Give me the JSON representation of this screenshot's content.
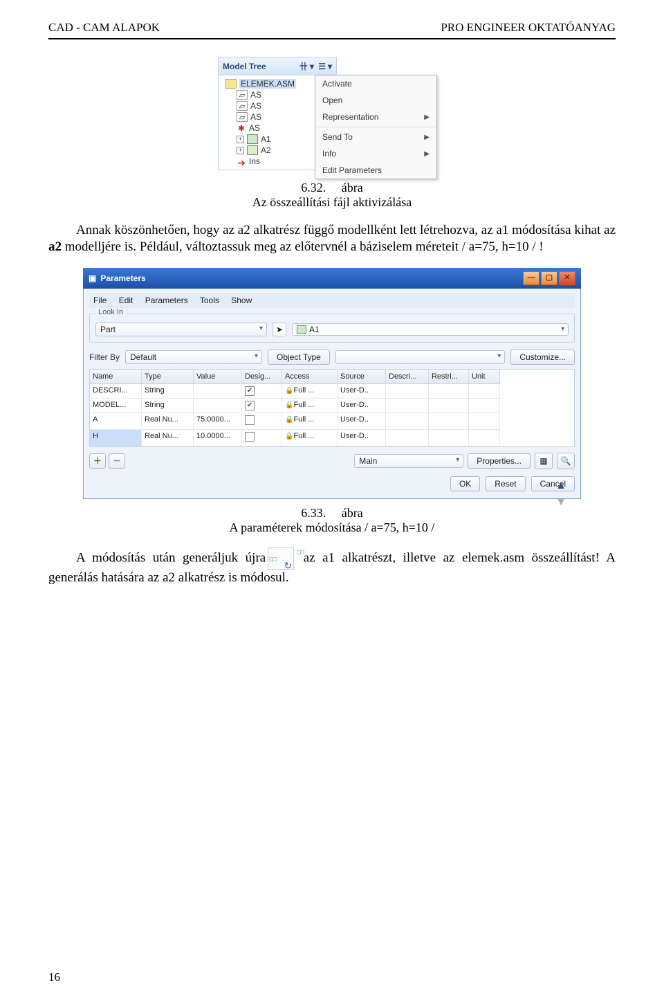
{
  "header": {
    "left": "CAD - CAM ALAPOK",
    "right": "PRO ENGINEER OKTATÓANYAG"
  },
  "shot1": {
    "tree_title": "Model Tree",
    "root": "ELEMEK.ASM",
    "children": [
      "AS",
      "AS",
      "AS",
      "AS",
      "A1",
      "A2",
      "Ins"
    ],
    "ctx": {
      "activate": "Activate",
      "open": "Open",
      "representation": "Representation",
      "sendto": "Send To",
      "info": "Info",
      "editparams": "Edit Parameters"
    }
  },
  "caption1": {
    "num": "6.32.",
    "label": "ábra",
    "text": "Az összeállítási fájl aktivizálása"
  },
  "para1_a": "Annak köszönhetően, hogy az a2 alkatrész függő modellként lett létrehozva, az a1 módosítása kihat az ",
  "para1_b": "a2",
  "para1_c": " modelljére is. Például, változtassuk meg az előtervnél a báziselem méreteit / a=75, h=10 / !",
  "shot2": {
    "title": "Parameters",
    "menu": [
      "File",
      "Edit",
      "Parameters",
      "Tools",
      "Show"
    ],
    "lookin": "Look In",
    "part_combo": "Part",
    "partname": "A1",
    "filterby": "Filter By",
    "filter_default": "Default",
    "object_type": "Object Type",
    "customize": "Customize...",
    "cols": [
      "Name",
      "Type",
      "Value",
      "Desig...",
      "Access",
      "Source",
      "Descri...",
      "Restri...",
      "Unit"
    ],
    "rows": [
      {
        "name": "DESCRI...",
        "type": "String",
        "value": "",
        "desig": true,
        "access": "Full ...",
        "source": "User-D..",
        "descr": "",
        "restr": "",
        "unit": ""
      },
      {
        "name": "MODEL...",
        "type": "String",
        "value": "",
        "desig": true,
        "access": "Full ...",
        "source": "User-D..",
        "descr": "",
        "restr": "",
        "unit": ""
      },
      {
        "name": "A",
        "type": "Real Nu...",
        "value": "75.0000...",
        "desig": false,
        "access": "Full ...",
        "source": "User-D..",
        "descr": "",
        "restr": "",
        "unit": ""
      },
      {
        "name": "H",
        "type": "Real Nu...",
        "value": "10.0000...",
        "desig": false,
        "access": "Full ...",
        "source": "User-D..",
        "descr": "",
        "restr": "",
        "unit": "",
        "selected": true
      }
    ],
    "main": "Main",
    "properties": "Properties...",
    "ok": "OK",
    "reset": "Reset",
    "cancel": "Cancel"
  },
  "caption2": {
    "num": "6.33.",
    "label": "ábra",
    "text": "A paraméterek módosítása / a=75, h=10 /"
  },
  "para2_a": "A módosítás után generáljuk újra",
  "para2_b": " az a1 alkatrészt, illetve az elemek.asm összeállítást! A generálás hatására az a2 alkatrész is módosul.",
  "page_number": "16"
}
